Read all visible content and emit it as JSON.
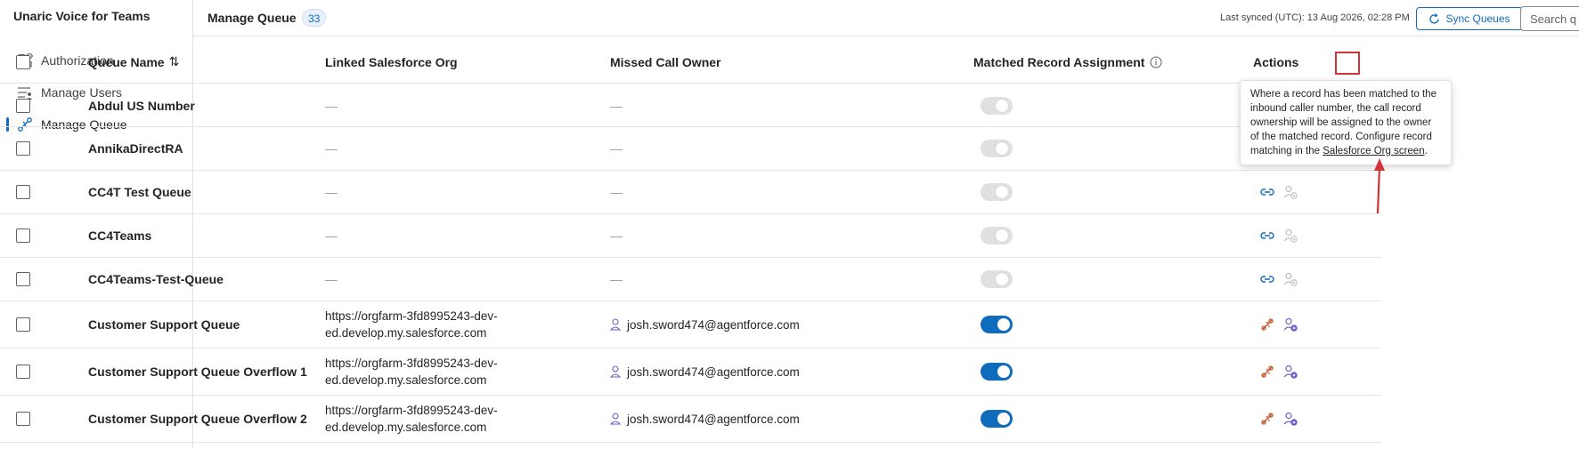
{
  "app": {
    "title": "Unaric Voice for Teams"
  },
  "sidebar": {
    "items": [
      {
        "label": "Authorization",
        "icon": "apps-grid-icon"
      },
      {
        "label": "Manage Users",
        "icon": "users-list-icon"
      },
      {
        "label": "Manage Queue",
        "icon": "queue-link-icon",
        "active": true
      }
    ]
  },
  "header": {
    "title": "Manage Queue",
    "count": "33",
    "last_synced": "Last synced (UTC): 13 Aug 2026, 02:28 PM",
    "sync_label": "Sync Queues",
    "search_placeholder": "Search q"
  },
  "table": {
    "columns": {
      "queue_name": "Queue Name",
      "sort_icon": "⇅",
      "linked_org": "Linked Salesforce Org",
      "missed_owner": "Missed Call Owner",
      "matched": "Matched Record Assignment",
      "actions": "Actions"
    },
    "rows": [
      {
        "name": "Abdul US Number",
        "org_line1": "—",
        "org_line2": "",
        "owner": "—",
        "matched_on": false
      },
      {
        "name": "AnnikaDirectRA",
        "org_line1": "—",
        "org_line2": "",
        "owner": "—",
        "matched_on": false
      },
      {
        "name": "CC4T Test Queue",
        "org_line1": "—",
        "org_line2": "",
        "owner": "—",
        "matched_on": false
      },
      {
        "name": "CC4Teams",
        "org_line1": "—",
        "org_line2": "",
        "owner": "—",
        "matched_on": false
      },
      {
        "name": "CC4Teams-Test-Queue",
        "org_line1": "—",
        "org_line2": "",
        "owner": "—",
        "matched_on": false
      },
      {
        "name": "Customer Support Queue",
        "org_line1": "https://orgfarm-3fd8995243-dev-",
        "org_line2": "ed.develop.my.salesforce.com",
        "owner": "josh.sword474@agentforce.com",
        "matched_on": true
      },
      {
        "name": "Customer Support Queue Overflow 1",
        "org_line1": "https://orgfarm-3fd8995243-dev-",
        "org_line2": "ed.develop.my.salesforce.com",
        "owner": "josh.sword474@agentforce.com",
        "matched_on": true
      },
      {
        "name": "Customer Support Queue Overflow 2",
        "org_line1": "https://orgfarm-3fd8995243-dev-",
        "org_line2": "ed.develop.my.salesforce.com",
        "owner": "josh.sword474@agentforce.com",
        "matched_on": true
      }
    ]
  },
  "tooltip": {
    "text_before": "Where a record has been matched to the inbound caller number, the call record ownership will be assigned to the owner of the matched record. Configure record matching in the ",
    "link": "Salesforce Org screen",
    "text_after": "."
  },
  "colors": {
    "accent": "#0f6cbd",
    "highlight": "#d13438",
    "linked_icon": "#c2552b",
    "owner_icon": "#6b5fc7"
  }
}
